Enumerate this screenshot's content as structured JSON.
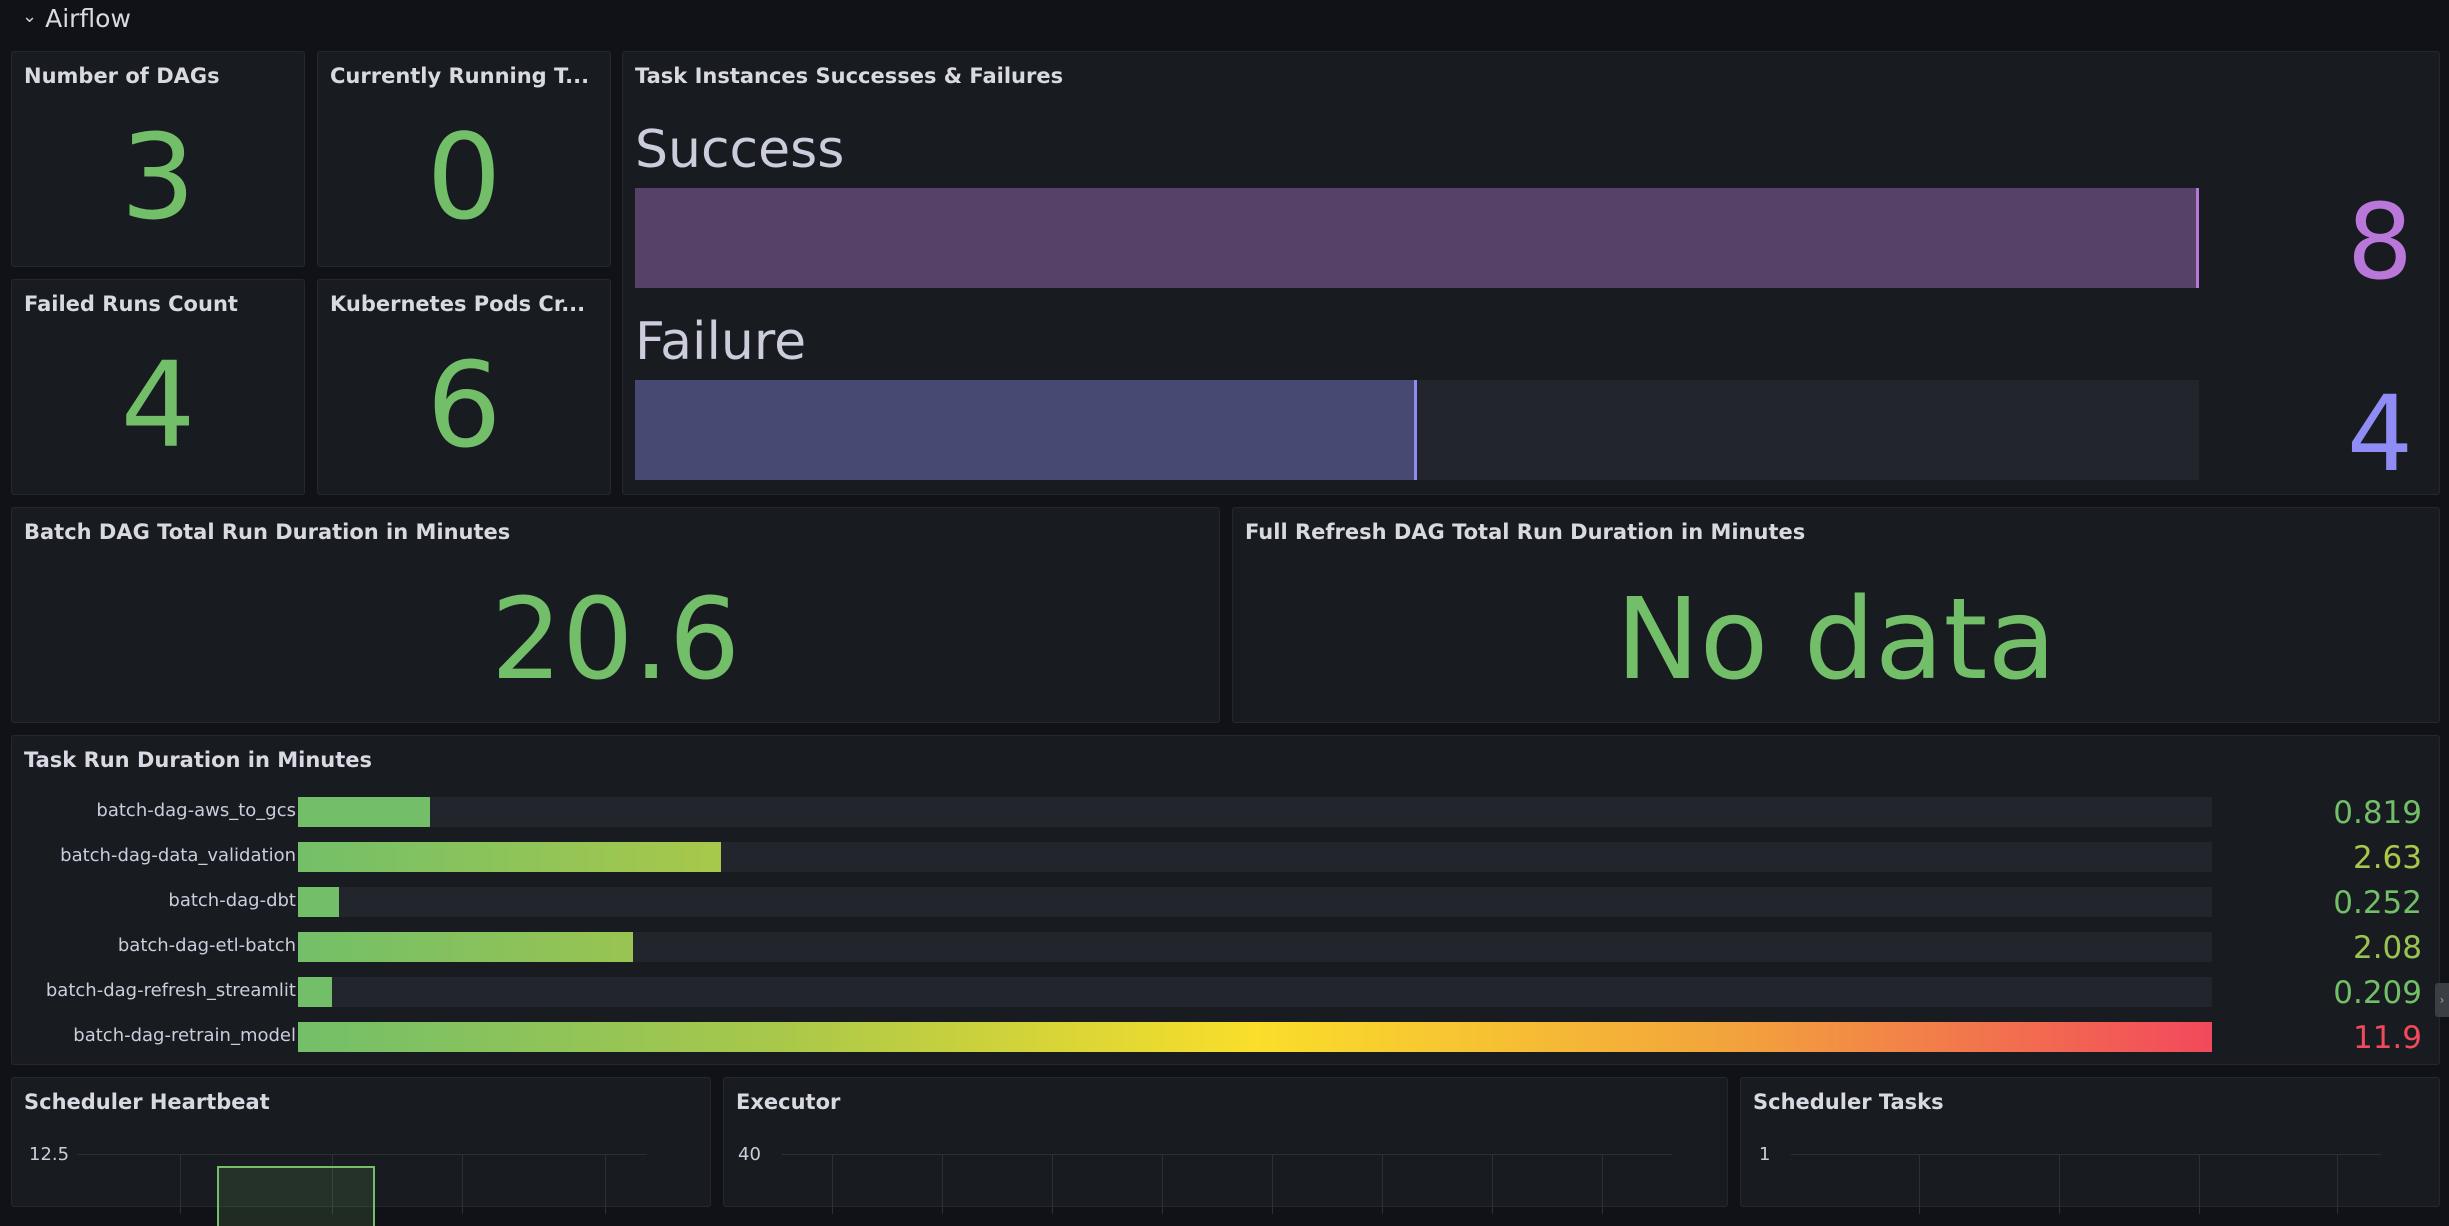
{
  "row": {
    "title": "Airflow"
  },
  "panels": {
    "dags": {
      "title": "Number of DAGs",
      "value": "3"
    },
    "running": {
      "title": "Currently Running T...",
      "value": "0"
    },
    "failed": {
      "title": "Failed Runs Count",
      "value": "4"
    },
    "pods": {
      "title": "Kubernetes Pods Cr...",
      "value": "6"
    },
    "task_instances": {
      "title": "Task Instances Successes & Failures",
      "items": [
        {
          "label": "Success",
          "value": "8",
          "fraction": 1.0,
          "color": "#b877d9"
        },
        {
          "label": "Failure",
          "value": "4",
          "fraction": 0.5,
          "color": "#8f8cf5"
        }
      ]
    },
    "batch_duration": {
      "title": "Batch DAG Total Run Duration in Minutes",
      "value": "20.6"
    },
    "full_refresh": {
      "title": "Full Refresh DAG Total Run Duration in Minutes",
      "value": "No data"
    },
    "task_run": {
      "title": "Task Run Duration in Minutes",
      "max": 11.9,
      "rows": [
        {
          "label": "batch-dag-aws_to_gcs",
          "value": "0.819",
          "num": 0.819,
          "color": "#73bf69"
        },
        {
          "label": "batch-dag-data_validation",
          "value": "2.63",
          "num": 2.63,
          "color": "#a8c84a"
        },
        {
          "label": "batch-dag-dbt",
          "value": "0.252",
          "num": 0.252,
          "color": "#73bf69"
        },
        {
          "label": "batch-dag-etl-batch",
          "value": "2.08",
          "num": 2.08,
          "color": "#99c451"
        },
        {
          "label": "batch-dag-refresh_streamlit",
          "value": "0.209",
          "num": 0.209,
          "color": "#73bf69"
        },
        {
          "label": "batch-dag-retrain_model",
          "value": "11.9",
          "num": 11.9,
          "color": "#f2495c"
        }
      ]
    },
    "heartbeat": {
      "title": "Scheduler Heartbeat",
      "tick": "12.5"
    },
    "executor": {
      "title": "Executor",
      "tick": "40"
    },
    "sched_tasks": {
      "title": "Scheduler Tasks",
      "tick": "1"
    }
  }
}
